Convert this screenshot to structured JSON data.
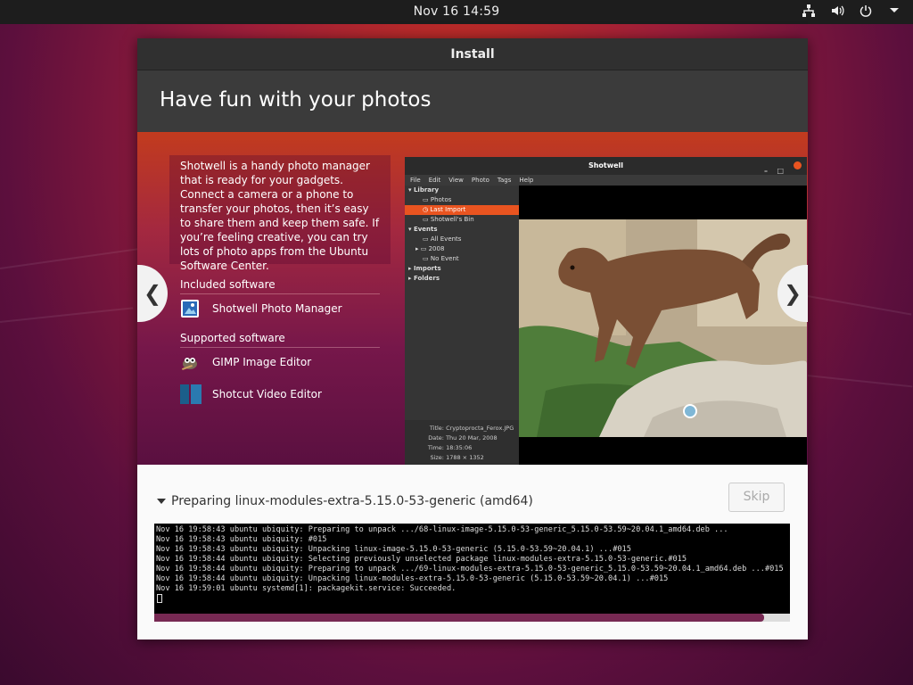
{
  "topbar": {
    "clock": "Nov 16  14:59",
    "icons": [
      "network-icon",
      "volume-icon",
      "power-icon",
      "menu-arrow-icon"
    ]
  },
  "window": {
    "title": "Install"
  },
  "slide": {
    "heading": "Have fun with your photos",
    "description": "Shotwell is a handy photo manager that is ready for your gadgets. Connect a camera or a phone to transfer your photos, then it’s easy to share them and keep them safe. If you’re feeling creative, you can try lots of photo apps from the Ubuntu Software Center.",
    "included_header": "Included software",
    "included_apps": [
      "Shotwell Photo Manager"
    ],
    "supported_header": "Supported software",
    "supported_apps": [
      "GIMP Image Editor",
      "Shotcut Video Editor"
    ],
    "prev_glyph": "❮",
    "next_glyph": "❯"
  },
  "shotwell_preview": {
    "title": "Shotwell",
    "menu": [
      "File",
      "Edit",
      "View",
      "Photo",
      "Tags",
      "Help"
    ],
    "sidebar": {
      "library": "Library",
      "photos": "Photos",
      "last_import": "Last Import",
      "bin": "Shotwell's Bin",
      "events": "Events",
      "all_events": "All Events",
      "year": "2008",
      "no_event": "No Event",
      "imports": "Imports",
      "folders": "Folders"
    },
    "meta": {
      "title_label": "Title:",
      "title_value": "Cryptoprocta_Ferox.JPG",
      "date_label": "Date:",
      "date_value": "Thu 20 Mar, 2008",
      "time_label": "Time:",
      "time_value": "18:35:06",
      "size_label": "Size:",
      "size_value": "1788 × 1352"
    }
  },
  "install": {
    "status": "Preparing linux-modules-extra-5.15.0-53-generic (amd64)",
    "skip_label": "Skip",
    "log_lines": [
      "Nov 16 19:58:43 ubuntu ubiquity: Preparing to unpack .../68-linux-image-5.15.0-53-generic_5.15.0-53.59~20.04.1_amd64.deb ...",
      "Nov 16 19:58:43 ubuntu ubiquity: #015",
      "Nov 16 19:58:43 ubuntu ubiquity: Unpacking linux-image-5.15.0-53-generic (5.15.0-53.59~20.04.1) ...#015",
      "Nov 16 19:58:44 ubuntu ubiquity: Selecting previously unselected package linux-modules-extra-5.15.0-53-generic.#015",
      "Nov 16 19:58:44 ubuntu ubiquity: Preparing to unpack .../69-linux-modules-extra-5.15.0-53-generic_5.15.0-53.59~20.04.1_amd64.deb ...#015",
      "Nov 16 19:58:44 ubuntu ubiquity: Unpacking linux-modules-extra-5.15.0-53-generic (5.15.0-53.59~20.04.1) ...#015",
      "Nov 16 19:59:01 ubuntu systemd[1]: packagekit.service: Succeeded."
    ],
    "progress": 0.96
  },
  "colors": {
    "accent": "#e95420",
    "progress": "#772953",
    "titlebar": "#303030"
  }
}
